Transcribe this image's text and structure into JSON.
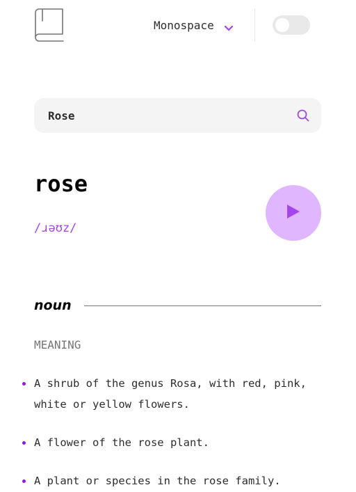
{
  "header": {
    "logo_icon": "book-icon",
    "font_selector": {
      "selected": "Monospace",
      "icon": "chevron-down-icon"
    },
    "theme_toggle": {
      "state": "off"
    }
  },
  "search": {
    "value": "Rose",
    "icon": "search-icon"
  },
  "entry": {
    "word": "rose",
    "phonetic": "/ɹəʊz/",
    "play_icon": "play-icon"
  },
  "meanings": [
    {
      "part_of_speech": "noun",
      "heading": "MEANING",
      "definitions": [
        "A shrub of the genus Rosa, with red, pink, white or yellow flowers.",
        "A flower of the rose plant.",
        "A plant or species in the rose family."
      ]
    }
  ],
  "colors": {
    "accent": "#a445ed",
    "play_button_bg": "#dfb6ff",
    "search_bg": "#f4f4f4",
    "muted_text": "#757575"
  }
}
